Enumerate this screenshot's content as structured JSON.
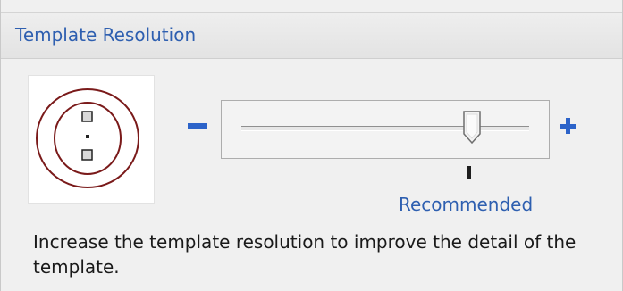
{
  "section": {
    "title": "Template Resolution"
  },
  "slider": {
    "minus_label": "−",
    "plus_label": "+",
    "value_fraction": 0.8,
    "recommended_label": "Recommended"
  },
  "description": "Increase the template resolution to improve the detail of the template.",
  "colors": {
    "accent": "#2e5fb0",
    "preview_ring": "#7a1a1a"
  }
}
